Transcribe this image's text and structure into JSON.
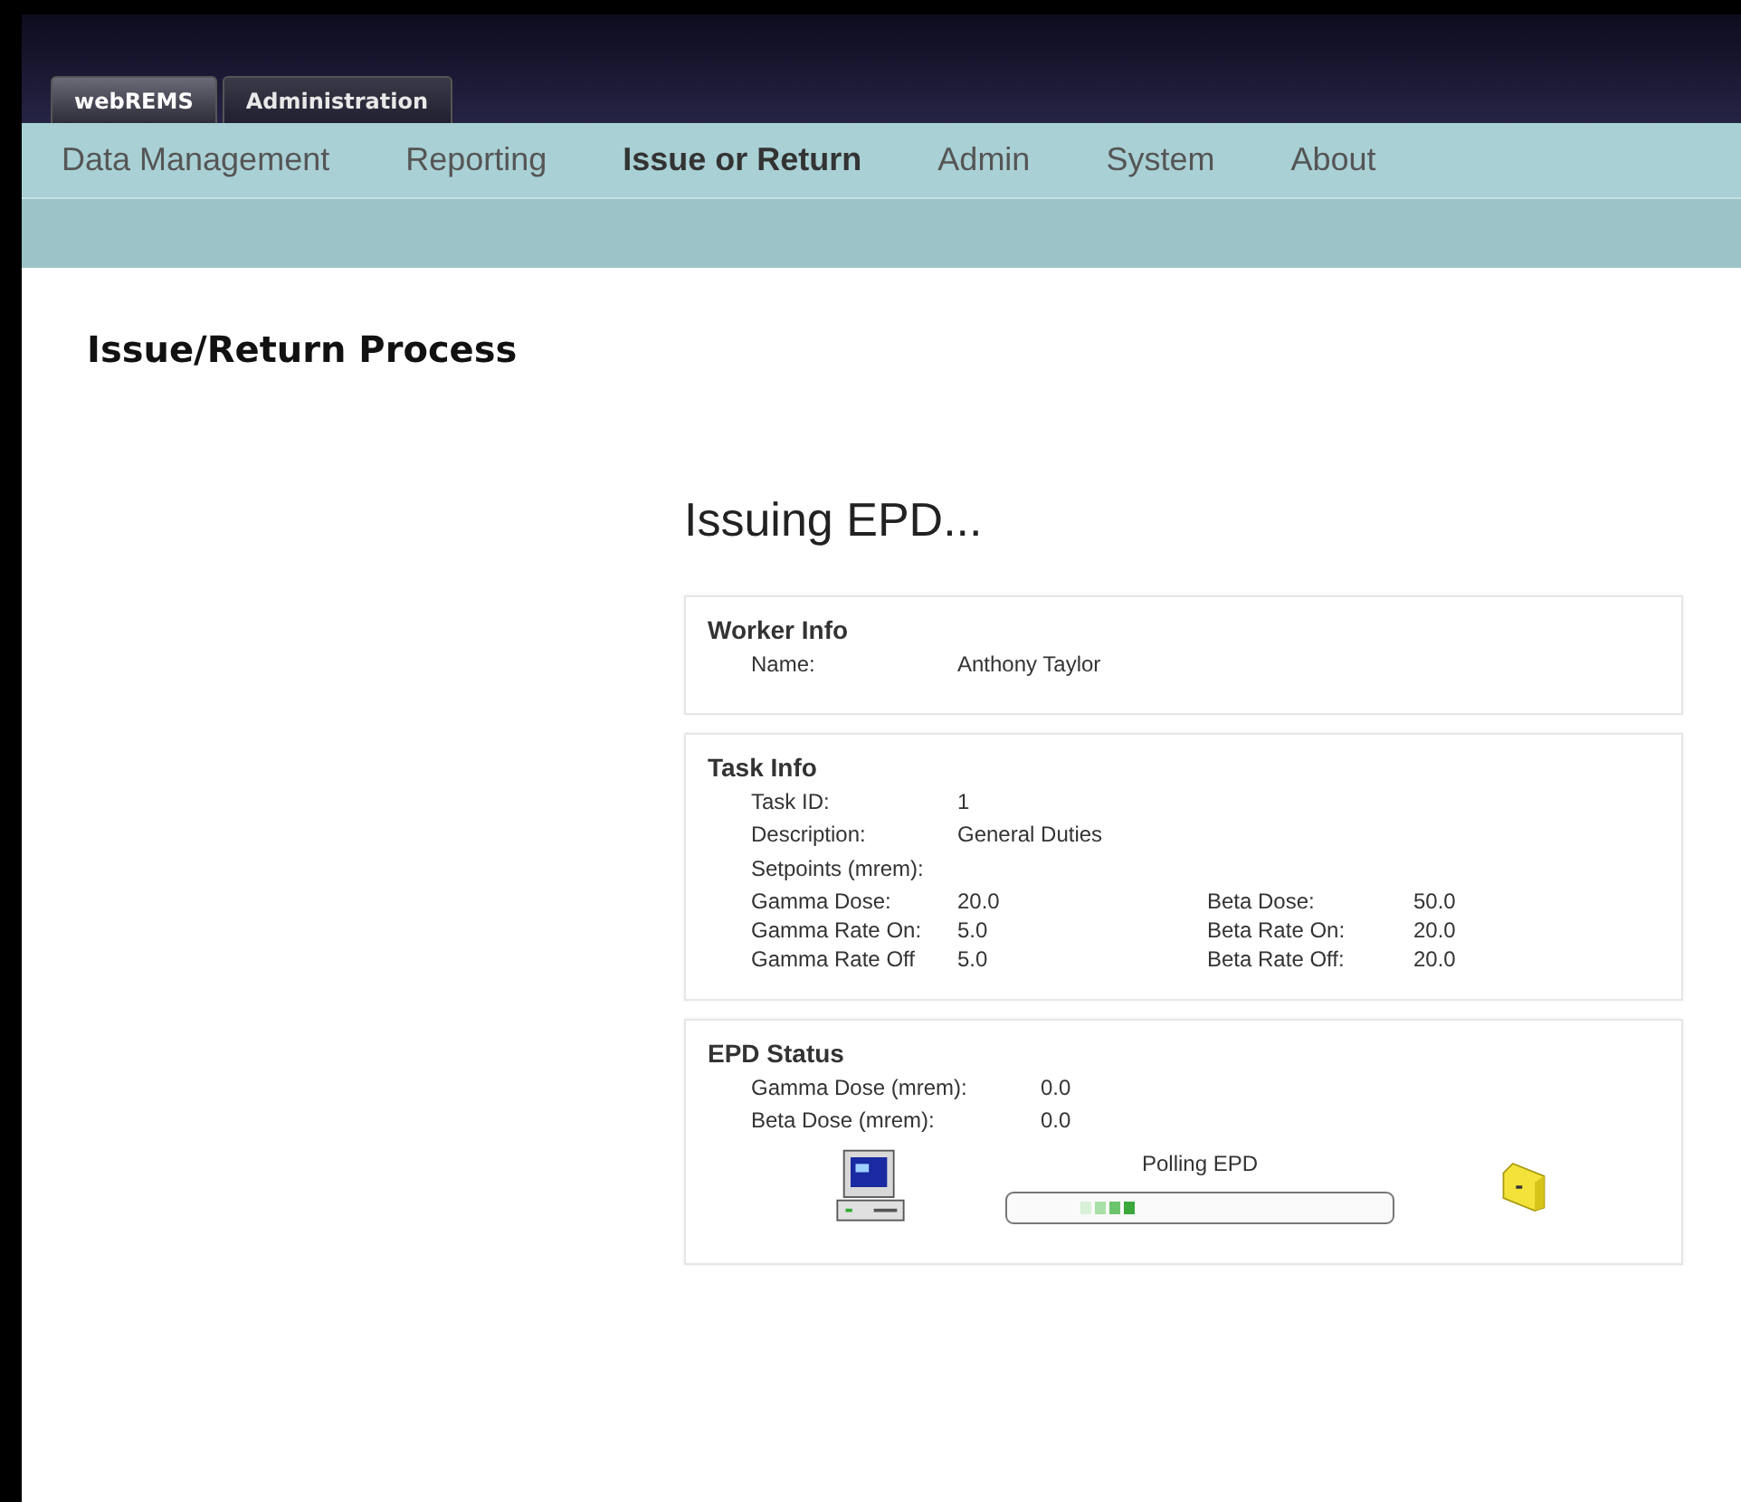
{
  "app_tabs": [
    {
      "label": "webREMS",
      "selected": true
    },
    {
      "label": "Administration",
      "selected": false
    }
  ],
  "menu": [
    {
      "label": "Data Management",
      "selected": false
    },
    {
      "label": "Reporting",
      "selected": false
    },
    {
      "label": "Issue or Return",
      "selected": true
    },
    {
      "label": "Admin",
      "selected": false
    },
    {
      "label": "System",
      "selected": false
    },
    {
      "label": "About",
      "selected": false
    }
  ],
  "page_title": "Issue/Return Process",
  "heading": "Issuing EPD...",
  "worker_info": {
    "title": "Worker Info",
    "fields": [
      {
        "label": "Name:",
        "value": "Anthony Taylor"
      }
    ]
  },
  "task_info": {
    "title": "Task Info",
    "fields": [
      {
        "label": "Task ID:",
        "value": "1"
      },
      {
        "label": "Description:",
        "value": "General Duties"
      }
    ],
    "setpoints_label": "Setpoints (mrem):",
    "setpoints": [
      {
        "label": "Gamma Dose:",
        "value": "20.0",
        "label_2": "Beta Dose:",
        "value_2": "50.0"
      },
      {
        "label": "Gamma Rate On:",
        "value": "5.0",
        "label_2": "Beta Rate On:",
        "value_2": "20.0"
      },
      {
        "label": "Gamma Rate Off",
        "value": "5.0",
        "label_2": "Beta Rate Off:",
        "value_2": "20.0"
      }
    ]
  },
  "epd_status": {
    "title": "EPD Status",
    "fields": [
      {
        "label": "Gamma Dose (mrem):",
        "value": "0.0"
      },
      {
        "label": "Beta Dose (mrem):",
        "value": "0.0"
      }
    ],
    "progress_label": "Polling EPD"
  }
}
